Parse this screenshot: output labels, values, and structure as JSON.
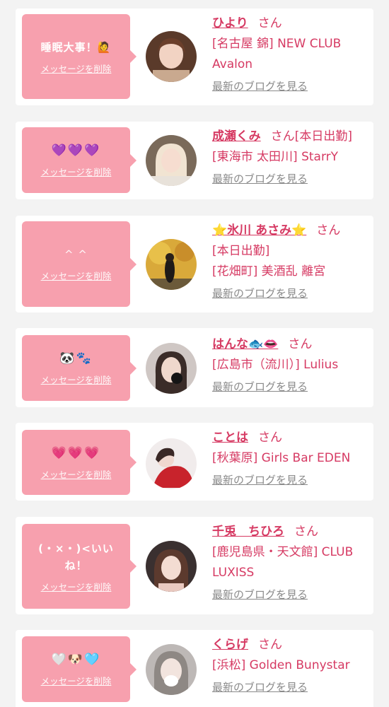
{
  "colors": {
    "accent": "#d63a63",
    "bubble": "#f7a0ae",
    "link_gray": "#8a8a8a",
    "background": "#f3f3f3"
  },
  "delete_label": "メッセージを削除",
  "blog_label": "最新のブログを見る",
  "honorific": "さん",
  "entries": [
    {
      "message": "睡眠大事！🙋",
      "name": "ひより",
      "suffix": "",
      "lines": [
        "[名古屋 錦] NEW CLUB Avalon"
      ],
      "avatar": "avatar-photo"
    },
    {
      "message": "💜💜💜",
      "name": "成瀬くみ",
      "suffix": "[本日出勤]",
      "lines": [
        "[東海市 太田川] StarrY"
      ],
      "avatar": "avatar-photo"
    },
    {
      "message": "^ ^",
      "name": "⭐氷川 あさみ⭐",
      "suffix": "",
      "lines": [
        "[本日出勤]",
        "[花畑町] 美酒乱 離宮"
      ],
      "avatar": "avatar-photo"
    },
    {
      "message": "🐼🐾",
      "name": "はんな🐟👄",
      "suffix": "",
      "lines": [
        "[広島市（流川）] Lulius"
      ],
      "avatar": "avatar-photo"
    },
    {
      "message": "💗💗💗",
      "name": "ことは",
      "suffix": "",
      "lines": [
        "[秋葉原] Girls Bar EDEN"
      ],
      "avatar": "avatar-photo"
    },
    {
      "message": "(・×・)<いいね！",
      "name": "千兎　ちひろ",
      "suffix": "",
      "lines": [
        "[鹿児島県・天文館] CLUB LUXISS"
      ],
      "avatar": "avatar-photo"
    },
    {
      "message": "🤍🐶🩵",
      "name": "くらげ",
      "suffix": "",
      "lines": [
        "[浜松] Golden Bunystar"
      ],
      "avatar": "avatar-photo"
    }
  ]
}
